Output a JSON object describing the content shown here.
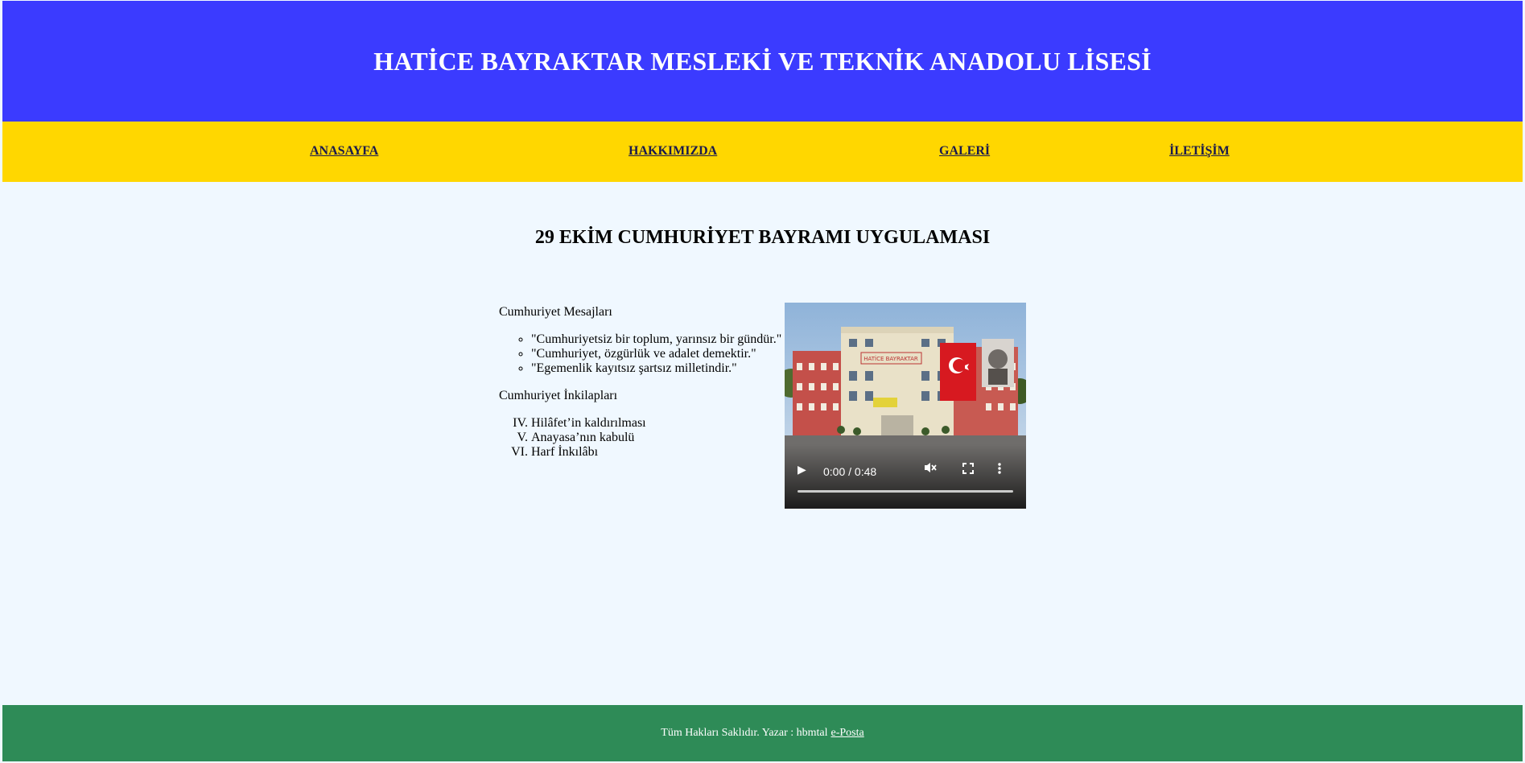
{
  "header": {
    "title": "HATİCE BAYRAKTAR MESLEKİ VE TEKNİK ANADOLU LİSESİ"
  },
  "nav": {
    "items": [
      {
        "label": "ANASAYFA"
      },
      {
        "label": "HAKKIMIZDA"
      },
      {
        "label": "GALERİ"
      },
      {
        "label": "İLETİŞİM"
      }
    ]
  },
  "main": {
    "title": "29 EKİM CUMHURİYET BAYRAMI UYGULAMASI",
    "messages_heading": "Cumhuriyet Mesajları",
    "messages": [
      "\"Cumhuriyetsiz bir toplum, yarınsız bir gündür.\"",
      "\"Cumhuriyet, özgürlük ve adalet demektir.\"",
      "\"Egemenlik kayıtsız şartsız milletindir.\""
    ],
    "reforms_heading": "Cumhuriyet İnkilapları",
    "reforms_start": 4,
    "reforms": [
      "Hilâfet’in kaldırılması",
      "Anayasa’nın kabulü",
      "Harf İnkılâbı"
    ]
  },
  "video": {
    "time": "0:00 / 0:48",
    "muted": true,
    "icons": {
      "play": "play-icon",
      "mute": "volume-muted-icon",
      "fullscreen": "fullscreen-icon",
      "more": "more-options-icon"
    }
  },
  "footer": {
    "text": "Tüm Hakları Saklıdır. Yazar : hbmtal",
    "link": "e-Posta"
  },
  "colors": {
    "header_bg": "#3b3bff",
    "nav_bg": "#ffd700",
    "content_bg": "#f0f8ff",
    "footer_bg": "#2e8b57"
  }
}
